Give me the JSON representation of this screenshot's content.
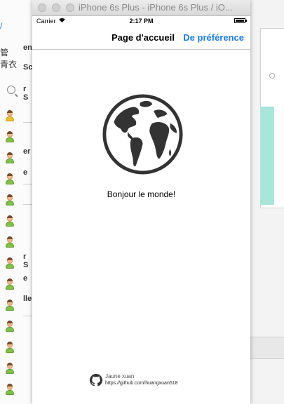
{
  "background_app": {
    "arrow": "/",
    "label_1": "管",
    "label_2": "青衣",
    "row_labels": [
      "en",
      "Sc",
      "r S",
      "er",
      "e",
      "r S",
      "e",
      "lle"
    ]
  },
  "window": {
    "title": "iPhone 6s Plus - iPhone 6s Plus / iO..."
  },
  "status_bar": {
    "carrier": "Carrier",
    "time": "2:17 PM"
  },
  "nav_bar": {
    "title": "Page d'accueil",
    "right_button": "De préférence"
  },
  "content": {
    "greeting": "Bonjour le monde!"
  },
  "footer": {
    "author": "Jaune xuan",
    "url": "https://github.com/huangxuan518"
  },
  "colors": {
    "accent": "#1a7cf0",
    "globe": "#333333"
  }
}
